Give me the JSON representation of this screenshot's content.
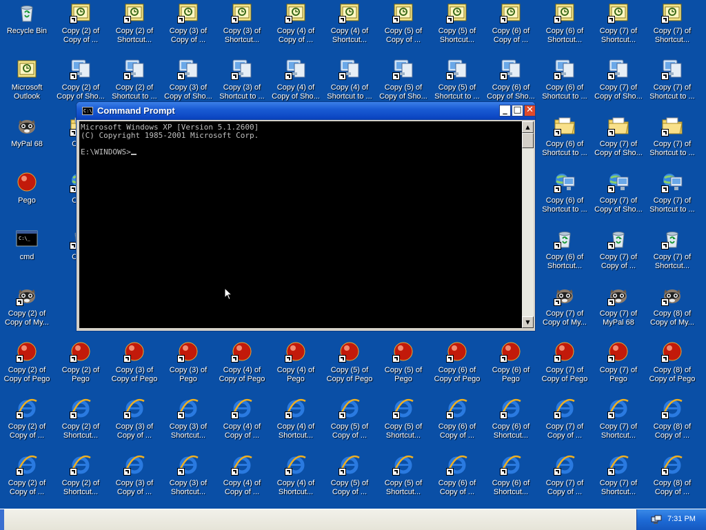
{
  "desktop": {
    "icons": [
      {
        "type": "recycle",
        "label": "Recycle Bin",
        "shortcut": false
      },
      {
        "type": "outlook",
        "label": "Copy (2) of Copy of ...",
        "shortcut": true
      },
      {
        "type": "outlook",
        "label": "Copy (2) of Shortcut...",
        "shortcut": true
      },
      {
        "type": "outlook",
        "label": "Copy (3) of Copy of ...",
        "shortcut": true
      },
      {
        "type": "outlook",
        "label": "Copy (3) of Shortcut...",
        "shortcut": true
      },
      {
        "type": "outlook",
        "label": "Copy (4) of Copy of ...",
        "shortcut": true
      },
      {
        "type": "outlook",
        "label": "Copy (4) of Shortcut...",
        "shortcut": true
      },
      {
        "type": "outlook",
        "label": "Copy (5) of Copy of ...",
        "shortcut": true
      },
      {
        "type": "outlook",
        "label": "Copy (5) of Shortcut...",
        "shortcut": true
      },
      {
        "type": "outlook",
        "label": "Copy (6) of Copy of ...",
        "shortcut": true
      },
      {
        "type": "outlook",
        "label": "Copy (6) of Shortcut...",
        "shortcut": true
      },
      {
        "type": "outlook",
        "label": "Copy (7) of Shortcut...",
        "shortcut": true
      },
      {
        "type": "outlook",
        "label": "Copy (7) of Shortcut...",
        "shortcut": true
      },
      {
        "type": "outlook",
        "label": "Microsoft Outlook",
        "shortcut": false
      },
      {
        "type": "computer",
        "label": "Copy (2) of Copy of Sho...",
        "shortcut": true
      },
      {
        "type": "computer",
        "label": "Copy (2) of Shortcut to ...",
        "shortcut": true
      },
      {
        "type": "computer",
        "label": "Copy (3) of Copy of Sho...",
        "shortcut": true
      },
      {
        "type": "computer",
        "label": "Copy (3) of Shortcut to ...",
        "shortcut": true
      },
      {
        "type": "computer",
        "label": "Copy (4) of Copy of Sho...",
        "shortcut": true
      },
      {
        "type": "computer",
        "label": "Copy (4) of Shortcut to ...",
        "shortcut": true
      },
      {
        "type": "computer",
        "label": "Copy (5) of Copy of Sho...",
        "shortcut": true
      },
      {
        "type": "computer",
        "label": "Copy (5) of Shortcut to ...",
        "shortcut": true
      },
      {
        "type": "computer",
        "label": "Copy (6) of Copy of Sho...",
        "shortcut": true
      },
      {
        "type": "computer",
        "label": "Copy (6) of Shortcut to ...",
        "shortcut": true
      },
      {
        "type": "computer",
        "label": "Copy (7) of Copy of Sho...",
        "shortcut": true
      },
      {
        "type": "computer",
        "label": "Copy (7) of Shortcut to ...",
        "shortcut": true
      },
      {
        "type": "raccoon",
        "label": "MyPal 68",
        "shortcut": false
      },
      {
        "type": "folder",
        "label": "Copy",
        "shortcut": true
      },
      {
        "type": "folder",
        "label": "Copy (6) of Shortcut to ...",
        "shortcut": true
      },
      {
        "type": "folder",
        "label": "Copy (7) of Copy of Sho...",
        "shortcut": true
      },
      {
        "type": "folder",
        "label": "Copy (7) of Shortcut to ...",
        "shortcut": true
      },
      {
        "type": "pego",
        "label": "Pego",
        "shortcut": false
      },
      {
        "type": "network",
        "label": "Copy",
        "shortcut": true
      },
      {
        "type": "network",
        "label": "Copy (6) of Shortcut to ...",
        "shortcut": true
      },
      {
        "type": "network",
        "label": "Copy (7) of Copy of Sho...",
        "shortcut": true
      },
      {
        "type": "network",
        "label": "Copy (7) of Shortcut to ...",
        "shortcut": true
      },
      {
        "type": "cmd",
        "label": "cmd",
        "shortcut": false
      },
      {
        "type": "recycle",
        "label": "Copy",
        "shortcut": true
      },
      {
        "type": "recycle",
        "label": "Copy (6) of Shortcut...",
        "shortcut": true
      },
      {
        "type": "recycle",
        "label": "Copy (7) of Copy of ...",
        "shortcut": true
      },
      {
        "type": "recycle",
        "label": "Copy (7) of Shortcut...",
        "shortcut": true
      },
      {
        "type": "raccoon",
        "label": "Copy (2) of Copy of My...",
        "shortcut": true
      },
      {
        "type": "raccoon",
        "label": "Copy (7) of Copy of My...",
        "shortcut": true
      },
      {
        "type": "raccoon",
        "label": "Copy (7) of MyPal 68",
        "shortcut": true
      },
      {
        "type": "raccoon",
        "label": "Copy (8) of Copy of My...",
        "shortcut": true
      },
      {
        "type": "pego",
        "label": "Copy (2) of Copy of Pego",
        "shortcut": true
      },
      {
        "type": "pego",
        "label": "Copy (2) of Pego",
        "shortcut": true
      },
      {
        "type": "pego",
        "label": "Copy (3) of Copy of Pego",
        "shortcut": true
      },
      {
        "type": "pego",
        "label": "Copy (3) of Pego",
        "shortcut": true
      },
      {
        "type": "pego",
        "label": "Copy (4) of Copy of Pego",
        "shortcut": true
      },
      {
        "type": "pego",
        "label": "Copy (4) of Pego",
        "shortcut": true
      },
      {
        "type": "pego",
        "label": "Copy (5) of Copy of Pego",
        "shortcut": true
      },
      {
        "type": "pego",
        "label": "Copy (5) of Pego",
        "shortcut": true
      },
      {
        "type": "pego",
        "label": "Copy (6) of Copy of Pego",
        "shortcut": true
      },
      {
        "type": "pego",
        "label": "Copy (6) of Pego",
        "shortcut": true
      },
      {
        "type": "pego",
        "label": "Copy (7) of Copy of Pego",
        "shortcut": true
      },
      {
        "type": "pego",
        "label": "Copy (7) of Pego",
        "shortcut": true
      },
      {
        "type": "pego",
        "label": "Copy (8) of Copy of Pego",
        "shortcut": true
      },
      {
        "type": "ie",
        "label": "Copy (2) of Copy of ...",
        "shortcut": true
      },
      {
        "type": "ie",
        "label": "Copy (2) of Shortcut...",
        "shortcut": true
      },
      {
        "type": "ie",
        "label": "Copy (3) of Copy of ...",
        "shortcut": true
      },
      {
        "type": "ie",
        "label": "Copy (3) of Shortcut...",
        "shortcut": true
      },
      {
        "type": "ie",
        "label": "Copy (4) of Copy of ...",
        "shortcut": true
      },
      {
        "type": "ie",
        "label": "Copy (4) of Shortcut...",
        "shortcut": true
      },
      {
        "type": "ie",
        "label": "Copy (5) of Copy of ...",
        "shortcut": true
      },
      {
        "type": "ie",
        "label": "Copy (5) of Shortcut...",
        "shortcut": true
      },
      {
        "type": "ie",
        "label": "Copy (6) of Copy of ...",
        "shortcut": true
      },
      {
        "type": "ie",
        "label": "Copy (6) of Shortcut...",
        "shortcut": true
      },
      {
        "type": "ie",
        "label": "Copy (7) of Copy of ...",
        "shortcut": true
      },
      {
        "type": "ie",
        "label": "Copy (7) of Shortcut...",
        "shortcut": true
      },
      {
        "type": "ie",
        "label": "Copy (8) of Copy of ...",
        "shortcut": true
      },
      {
        "type": "ie",
        "label": "Copy (2) of Copy of ...",
        "shortcut": true
      },
      {
        "type": "ie",
        "label": "Copy (2) of Shortcut...",
        "shortcut": true
      },
      {
        "type": "ie",
        "label": "Copy (3) of Copy of ...",
        "shortcut": true
      },
      {
        "type": "ie",
        "label": "Copy (3) of Shortcut...",
        "shortcut": true
      },
      {
        "type": "ie",
        "label": "Copy (4) of Copy of ...",
        "shortcut": true
      },
      {
        "type": "ie",
        "label": "Copy (4) of Shortcut...",
        "shortcut": true
      },
      {
        "type": "ie",
        "label": "Copy (5) of Copy of ...",
        "shortcut": true
      },
      {
        "type": "ie",
        "label": "Copy (5) of Shortcut...",
        "shortcut": true
      },
      {
        "type": "ie",
        "label": "Copy (6) of Copy of ...",
        "shortcut": true
      },
      {
        "type": "ie",
        "label": "Copy (6) of Shortcut...",
        "shortcut": true
      },
      {
        "type": "ie",
        "label": "Copy (7) of Copy of ...",
        "shortcut": true
      },
      {
        "type": "ie",
        "label": "Copy (7) of Shortcut...",
        "shortcut": true
      },
      {
        "type": "ie",
        "label": "Copy (8) of Copy of ...",
        "shortcut": true
      }
    ]
  },
  "cmd_window": {
    "title": "Command Prompt",
    "icon_text": "C:\\",
    "buttons": {
      "minimize": "_",
      "maximize": "□",
      "close": "✕"
    },
    "lines": [
      "Microsoft Windows XP [Version 5.1.2600]",
      "(C) Copyright 1985-2001 Microsoft Corp.",
      "",
      "E:\\WINDOWS>"
    ],
    "scroll": {
      "up": "▲",
      "down": "▼"
    }
  },
  "taskbar": {
    "clock": "7:31 PM"
  },
  "colors": {
    "desktop_bg": "#0a4fa6",
    "titlebar": "#0b45c2",
    "console_bg": "#000000",
    "console_fg": "#c0c0c0"
  }
}
